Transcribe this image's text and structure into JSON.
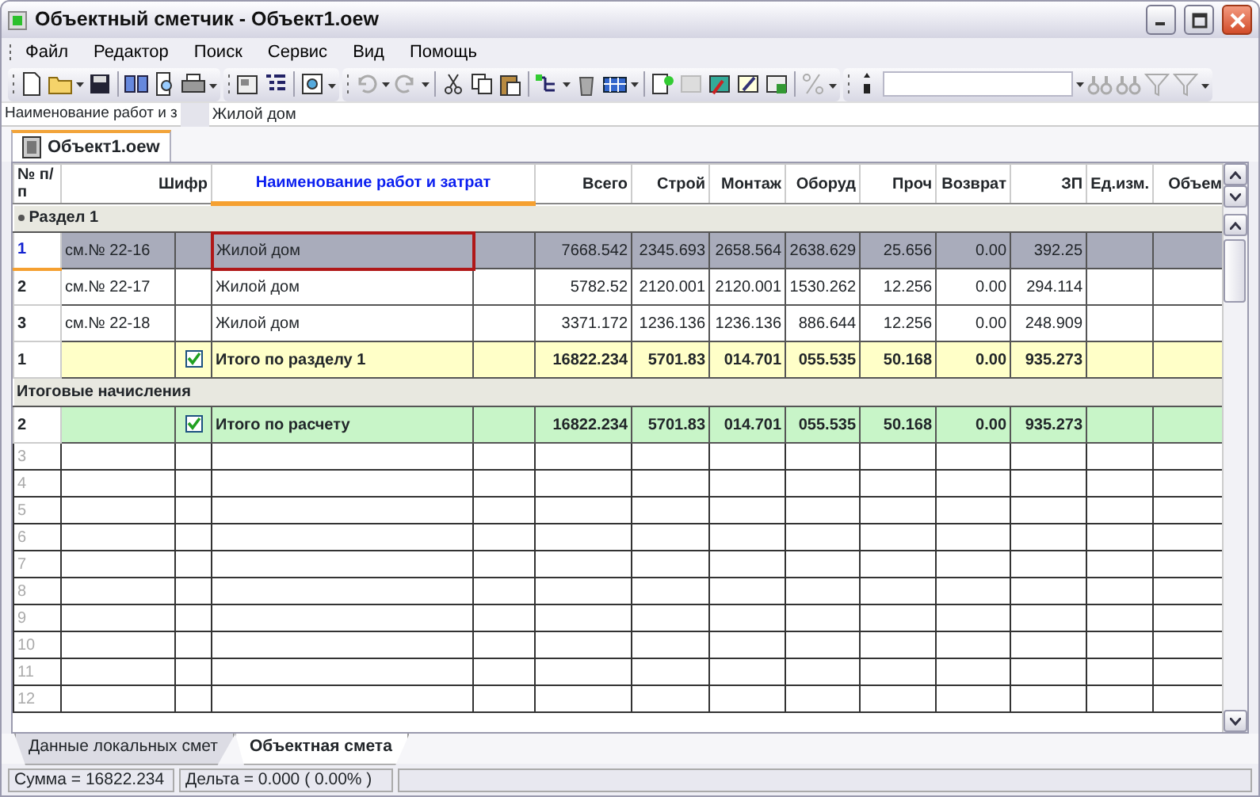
{
  "window": {
    "title": "Объектный сметчик  - Объект1.oew"
  },
  "menu": [
    "Файл",
    "Редактор",
    "Поиск",
    "Сервис",
    "Вид",
    "Помощь"
  ],
  "formula_bar": {
    "label": "Наименование работ и з",
    "value": "Жилой дом"
  },
  "document_tab": {
    "label": "Объект1.oew",
    "selected": true
  },
  "table": {
    "columns": [
      {
        "label": "№ п/п",
        "selected": false
      },
      {
        "label": "Шифр",
        "selected": false
      },
      {
        "label": "Наименование работ и затрат",
        "selected": true
      },
      {
        "label": "Всего",
        "selected": false
      },
      {
        "label": "Строй",
        "selected": false
      },
      {
        "label": "Монтаж",
        "selected": false
      },
      {
        "label": "Оборуд",
        "selected": false
      },
      {
        "label": "Проч",
        "selected": false
      },
      {
        "label": "Возврат",
        "selected": false
      },
      {
        "label": "ЗП",
        "selected": false
      },
      {
        "label": "Ед.изм.",
        "selected": false
      },
      {
        "label": "Объем",
        "selected": false
      }
    ],
    "rows": [
      {
        "kind": "section",
        "label": "Раздел 1",
        "marked": true
      },
      {
        "kind": "item",
        "num": "1",
        "code": "см.№ 22-16",
        "name": "Жилой дом",
        "values": [
          "7668.542",
          "2345.693",
          "2658.564",
          "2638.629",
          "25.656",
          "0.00",
          "392.25"
        ],
        "selected": true
      },
      {
        "kind": "item",
        "num": "2",
        "code": "см.№ 22-17",
        "name": "Жилой дом",
        "values": [
          "5782.52",
          "2120.001",
          "2120.001",
          "1530.262",
          "12.256",
          "0.00",
          "294.114"
        ],
        "selected": false
      },
      {
        "kind": "item",
        "num": "3",
        "code": "см.№ 22-18",
        "name": "Жилой дом",
        "values": [
          "3371.172",
          "1236.136",
          "1236.136",
          "886.644",
          "12.256",
          "0.00",
          "248.909"
        ],
        "selected": false
      },
      {
        "kind": "total",
        "num": "1",
        "checked": true,
        "name": "Итого по разделу 1",
        "color": "#ffffc8",
        "values": [
          "16822.234",
          "5701.83",
          "014.701",
          "055.535",
          "50.168",
          "0.00",
          "935.273"
        ]
      },
      {
        "kind": "section",
        "label": "Итоговые начисления",
        "marked": false
      },
      {
        "kind": "total",
        "num": "2",
        "checked": true,
        "name": "Итого по расчету",
        "color": "#c8f5c8",
        "values": [
          "16822.234",
          "5701.83",
          "014.701",
          "055.535",
          "50.168",
          "0.00",
          "935.273"
        ]
      },
      {
        "kind": "empty",
        "num": "3"
      },
      {
        "kind": "empty",
        "num": "4"
      },
      {
        "kind": "empty",
        "num": "5"
      },
      {
        "kind": "empty",
        "num": "6"
      },
      {
        "kind": "empty",
        "num": "7"
      },
      {
        "kind": "empty",
        "num": "8"
      },
      {
        "kind": "empty",
        "num": "9"
      },
      {
        "kind": "empty",
        "num": "10"
      },
      {
        "kind": "empty",
        "num": "11"
      },
      {
        "kind": "empty",
        "num": "12"
      }
    ]
  },
  "sheet_tabs": [
    {
      "label": "Данные локальных смет",
      "selected": false
    },
    {
      "label": "Объектная смета",
      "selected": true
    }
  ],
  "status_bar": [
    "Сумма = 16822.234",
    "Дельта = 0.000 ( 0.00% )"
  ]
}
